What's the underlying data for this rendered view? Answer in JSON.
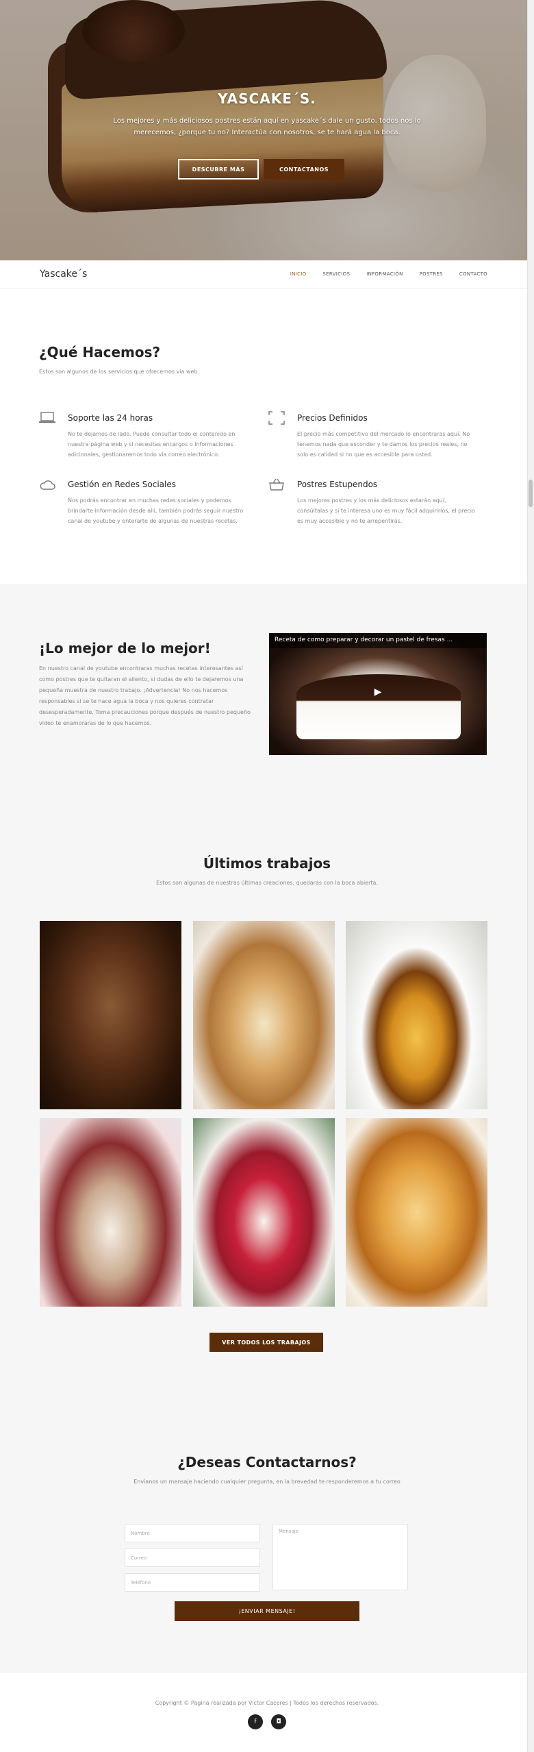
{
  "hero": {
    "title": "YASCAKE´S.",
    "subtitle": "Los mejores y más deliciosos postres están aquí en yascake´s dale un gusto, todos nos lo merecemos, ¿porque tu no? Interactúa con nosotros, se te hará agua la boca.",
    "btn_more": "DESCUBRE MÁS",
    "btn_contact": "CONTACTANOS"
  },
  "nav": {
    "brand": "Yascake´s",
    "items": [
      "INICIO",
      "SERVICIOS",
      "INFORMACIÓN",
      "POSTRES",
      "CONTACTO"
    ]
  },
  "services": {
    "title": "¿Qué Hacemos?",
    "subtitle": "Estos son algunos de los servicios que ofrecemos vía web.",
    "items": [
      {
        "icon": "laptop-icon",
        "title": "Soporte las 24 horas",
        "text": "No te dejamos de lado. Puede consultar todo el contenido en nuestra página web y si necesitas encargos o informaciones adicionales, gestionaremos todo vía correo electrónico."
      },
      {
        "icon": "expand-icon",
        "title": "Precios Definidos",
        "text": "El precio más competitivo del mercado lo encontraras aquí. No tenemos nada que esconder y te damos los precios reales, no solo es calidad si no que es accesible para usted."
      },
      {
        "icon": "cloud-icon",
        "title": "Gestión en Redes Sociales",
        "text": "Nos podrás encontrar en muchas redes sociales y podemos brindarte información desde allí, también podrás seguir nuestro canal de youtube y enterarte de algunas de nuestras recetas."
      },
      {
        "icon": "basket-icon",
        "title": "Postres Estupendos",
        "text": "Los mejores postres y los más deliciosos estarán aquí, consúltalas y si te interesa uno es muy fácil adquirirlos, el precio es muy accesible y no te arrepentirás."
      }
    ]
  },
  "best": {
    "title": "¡Lo mejor de lo mejor!",
    "text": "En nuestro canal de youtube encontraras muchas recetas interesantes así como postres que te quitaran el aliento, si dudas de ello te dejaremos una pequeña muestra de nuestro trabajo. ¡Advertencia! No nos hacemos responsables si se te hace agua la boca y nos quieres contratar desesperadamente. Toma precauciones porque después de nuestro pequeño video te enamoraras de lo que hacemos.",
    "video_title": "Receta de como preparar y decorar un pastel de fresas ..."
  },
  "works": {
    "title": "Últimos trabajos",
    "subtitle": "Estos son algunas de nuestras últimas creaciones, quedaras con la boca abierta.",
    "button": "VER TODOS LOS TRABAJOS"
  },
  "contact": {
    "title": "¿Deseas Contactarnos?",
    "subtitle": "Envíanos un mensaje haciendo cualquier pregunta, en la brevedad te responderemos a tu correo",
    "name_ph": "Nombre",
    "email_ph": "Correo",
    "phone_ph": "Teléfono",
    "message_ph": "Mensaje",
    "button": "¡ENVIAR MENSAJE!"
  },
  "footer": {
    "copyright": "Copyright © Pagina realizada por Victor Caceres | Todos los derechos reservados.",
    "facebook": "f",
    "instagram": "◘"
  },
  "colors": {
    "accent": "#5c2d0a",
    "active_nav": "#8a5a1c"
  }
}
